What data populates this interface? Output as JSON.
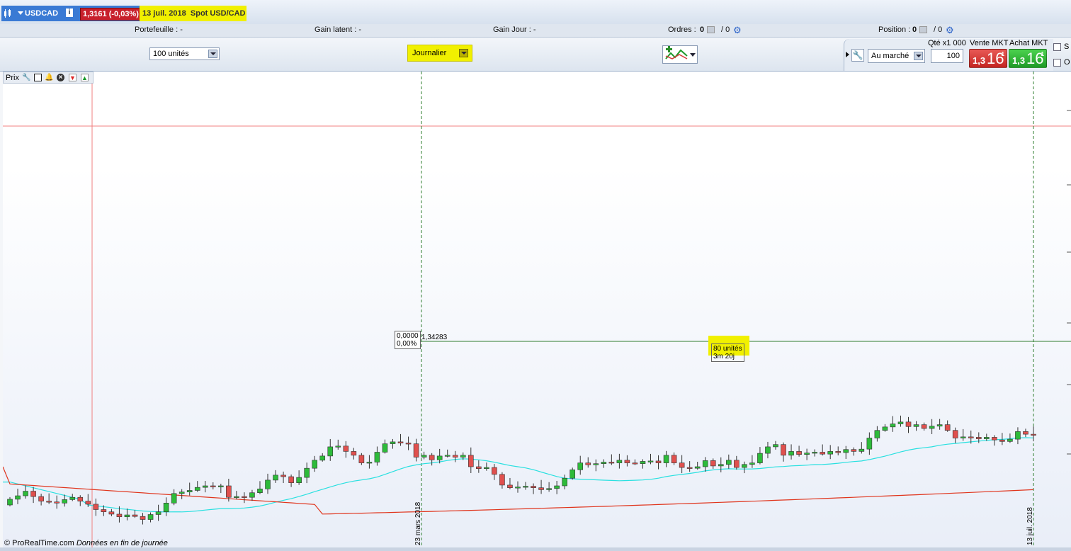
{
  "header": {
    "symbol": "USDCAD",
    "price_change": "1,3161 (-0,03%)",
    "date_label": "13 juil. 2018",
    "instrument": "Spot USD/CAD"
  },
  "info_row": {
    "portefeuille": "Portefeuille : -",
    "gain_latent": "Gain latent : -",
    "gain_jour": "Gain Jour : -",
    "ordres_label": "Ordres : ",
    "ordres_a": "0",
    "ordres_b": "/ 0",
    "position_label": "Position : ",
    "position_a": "0",
    "position_b": "/ 0"
  },
  "controls": {
    "units": "100 unités",
    "period": "Journalier",
    "order_type": "Au marché",
    "qty_label": "Qté x1 000",
    "qty_value": "100",
    "sell_label": "Vente MKT",
    "buy_label": "Achat MKT",
    "sell_small": "1,3",
    "sell_big": "16",
    "sell_sup": "1",
    "buy_small": "1,3",
    "buy_big": "16",
    "buy_sup": "1",
    "check1": "S",
    "check2": "O"
  },
  "chart": {
    "panel_label": "Prix",
    "cursor_value": "0,0000",
    "cursor_pct": "0,00%",
    "price_level": "1,34283",
    "measure_units": "80 unités",
    "measure_time": "3m 20j",
    "date_left": "23 mars 2018",
    "date_right": "13 juil. 2018",
    "footer_brand": "© ProRealTime.com",
    "footer_note": "Données en fin de journée",
    "colors": {
      "up": "#2dbb3a",
      "down": "#e0504e",
      "ma_fast": "#29e0e0",
      "ma_slow": "#e0341c",
      "level": "#2e7d2e"
    }
  },
  "chart_data": {
    "type": "candlestick",
    "candles_o_c": [
      [
        0.0,
        0.15
      ],
      [
        0.15,
        0.24
      ],
      [
        0.24,
        0.36
      ],
      [
        0.36,
        0.22
      ],
      [
        0.22,
        0.1
      ],
      [
        0.1,
        0.08
      ],
      [
        0.08,
        0.05
      ],
      [
        0.05,
        0.14
      ],
      [
        0.14,
        0.2
      ],
      [
        0.2,
        0.1
      ],
      [
        0.1,
        0.02
      ],
      [
        0.02,
        -0.12
      ],
      [
        -0.12,
        -0.18
      ],
      [
        -0.18,
        -0.24
      ],
      [
        -0.24,
        -0.31
      ],
      [
        -0.31,
        -0.26
      ],
      [
        -0.26,
        -0.3
      ],
      [
        -0.3,
        -0.38
      ],
      [
        -0.38,
        -0.25
      ],
      [
        -0.25,
        -0.18
      ],
      [
        -0.18,
        0.05
      ],
      [
        0.05,
        0.3
      ],
      [
        0.3,
        0.34
      ],
      [
        0.34,
        0.38
      ],
      [
        0.38,
        0.46
      ],
      [
        0.46,
        0.5
      ],
      [
        0.5,
        0.48
      ],
      [
        0.48,
        0.5
      ],
      [
        0.5,
        0.2
      ],
      [
        0.2,
        0.22
      ],
      [
        0.22,
        0.2
      ],
      [
        0.2,
        0.32
      ],
      [
        0.32,
        0.42
      ],
      [
        0.42,
        0.65
      ],
      [
        0.65,
        0.78
      ],
      [
        0.78,
        0.74
      ],
      [
        0.74,
        0.58
      ],
      [
        0.58,
        0.72
      ],
      [
        0.72,
        0.96
      ],
      [
        0.96,
        1.17
      ],
      [
        1.17,
        1.28
      ],
      [
        1.28,
        1.52
      ],
      [
        1.52,
        1.54
      ],
      [
        1.54,
        1.4
      ],
      [
        1.4,
        1.3
      ],
      [
        1.3,
        1.1
      ],
      [
        1.1,
        1.12
      ],
      [
        1.12,
        1.38
      ],
      [
        1.38,
        1.6
      ],
      [
        1.6,
        1.65
      ],
      [
        1.65,
        1.62
      ],
      [
        1.62,
        1.6
      ],
      [
        1.6,
        1.25
      ],
      [
        1.25,
        1.3
      ],
      [
        1.3,
        1.18
      ],
      [
        1.18,
        1.28
      ],
      [
        1.28,
        1.3
      ],
      [
        1.3,
        1.25
      ],
      [
        1.25,
        1.3
      ],
      [
        1.3,
        1.0
      ],
      [
        1.0,
        0.95
      ],
      [
        0.95,
        0.98
      ],
      [
        0.98,
        0.8
      ],
      [
        0.8,
        0.52
      ],
      [
        0.52,
        0.45
      ],
      [
        0.45,
        0.47
      ],
      [
        0.47,
        0.49
      ],
      [
        0.49,
        0.45
      ],
      [
        0.45,
        0.4
      ],
      [
        0.4,
        0.43
      ],
      [
        0.43,
        0.5
      ],
      [
        0.5,
        0.7
      ],
      [
        0.7,
        0.92
      ],
      [
        0.92,
        1.1
      ],
      [
        1.1,
        1.05
      ],
      [
        1.05,
        1.08
      ],
      [
        1.08,
        1.12
      ],
      [
        1.12,
        1.1
      ],
      [
        1.1,
        1.17
      ],
      [
        1.17,
        1.1
      ],
      [
        1.1,
        1.08
      ],
      [
        1.08,
        1.14
      ],
      [
        1.14,
        1.15
      ],
      [
        1.15,
        1.1
      ],
      [
        1.1,
        1.3
      ],
      [
        1.3,
        1.1
      ],
      [
        1.1,
        0.98
      ],
      [
        0.98,
        0.96
      ],
      [
        0.96,
        1.0
      ],
      [
        1.0,
        1.16
      ],
      [
        1.16,
        1.02
      ],
      [
        1.02,
        1.06
      ],
      [
        1.06,
        1.17
      ],
      [
        1.17,
        0.98
      ],
      [
        0.98,
        1.06
      ],
      [
        1.06,
        1.1
      ],
      [
        1.1,
        1.35
      ],
      [
        1.35,
        1.52
      ],
      [
        1.52,
        1.58
      ],
      [
        1.58,
        1.3
      ],
      [
        1.3,
        1.4
      ],
      [
        1.4,
        1.32
      ],
      [
        1.32,
        1.36
      ],
      [
        1.36,
        1.38
      ],
      [
        1.38,
        1.33
      ],
      [
        1.33,
        1.4
      ],
      [
        1.4,
        1.37
      ],
      [
        1.37,
        1.45
      ],
      [
        1.45,
        1.4
      ],
      [
        1.4,
        1.46
      ],
      [
        1.46,
        1.75
      ],
      [
        1.75,
        1.95
      ],
      [
        1.95,
        2.04
      ],
      [
        2.04,
        2.12
      ],
      [
        2.12,
        2.17
      ],
      [
        2.17,
        2.05
      ],
      [
        2.05,
        2.1
      ],
      [
        2.1,
        2.0
      ],
      [
        2.0,
        2.06
      ],
      [
        2.06,
        2.1
      ],
      [
        2.1,
        1.95
      ],
      [
        1.95,
        1.75
      ],
      [
        1.75,
        1.78
      ],
      [
        1.78,
        1.77
      ],
      [
        1.77,
        1.73
      ],
      [
        1.73,
        1.77
      ],
      [
        1.77,
        1.7
      ],
      [
        1.7,
        1.66
      ],
      [
        1.66,
        1.72
      ],
      [
        1.72,
        1.92
      ],
      [
        1.92,
        1.85
      ],
      [
        1.85,
        1.83
      ]
    ],
    "price_level": 1.34283,
    "ma_fast_style": "cyan",
    "ma_slow_style": "red",
    "x_labels": [
      "23 mars 2018",
      "13 juil. 2018"
    ]
  }
}
